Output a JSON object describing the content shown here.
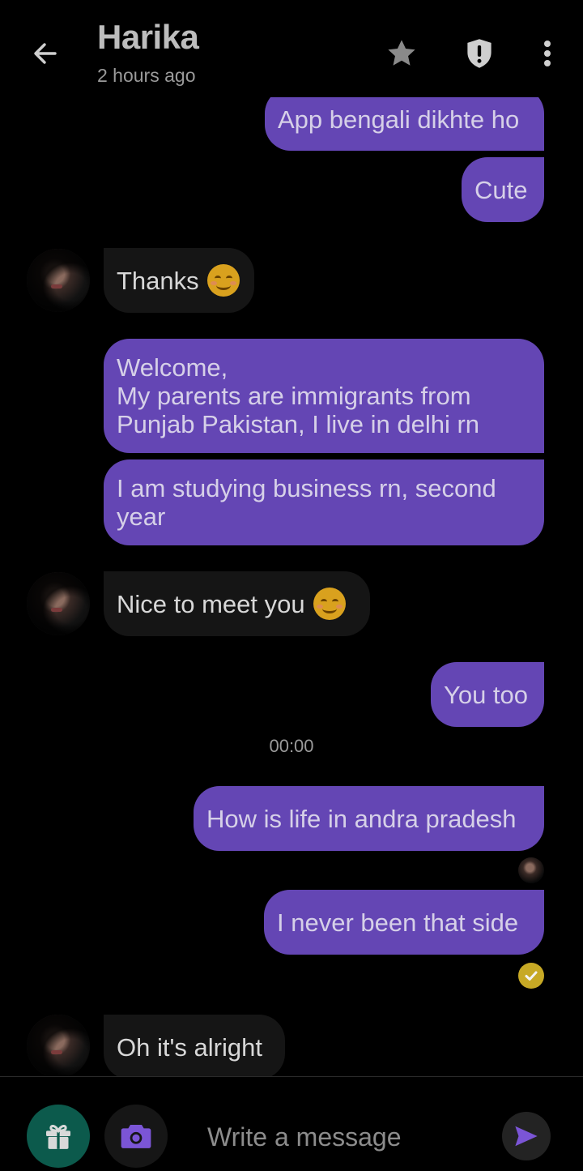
{
  "header": {
    "contact_name": "Harika",
    "last_seen": "2 hours ago",
    "icons": [
      "back-arrow-icon",
      "star-icon",
      "shield-icon",
      "more-vertical-icon"
    ]
  },
  "messages": [
    {
      "direction": "outgoing",
      "text": "App bengali dikhte ho"
    },
    {
      "direction": "outgoing",
      "text": "Cute"
    },
    {
      "direction": "incoming",
      "text": "Thanks",
      "emoji": "smiling-face-icon"
    },
    {
      "direction": "outgoing",
      "text": "Welcome,\nMy parents are immigrants from\nPunjab Pakistan, I live in delhi rn"
    },
    {
      "direction": "outgoing",
      "text": "I am studying business rn, second\nyear"
    },
    {
      "direction": "incoming",
      "text": "Nice to meet you",
      "emoji": "smiling-face-icon"
    },
    {
      "direction": "outgoing",
      "text": "You too"
    },
    {
      "direction": "outgoing",
      "text": "How is life in andra pradesh"
    },
    {
      "direction": "outgoing",
      "text": "I never been that side"
    },
    {
      "direction": "incoming",
      "text": "Oh it's alright"
    }
  ],
  "timestamp": "00:00",
  "composer": {
    "placeholder": "Write a message",
    "value": ""
  },
  "colors": {
    "background": "#000000",
    "outgoing_bubble": "#6446b4",
    "incoming_bubble": "#151515",
    "gift_button": "#0c5a4c",
    "accent": "#7b55d6",
    "read_check": "#c7a925"
  }
}
